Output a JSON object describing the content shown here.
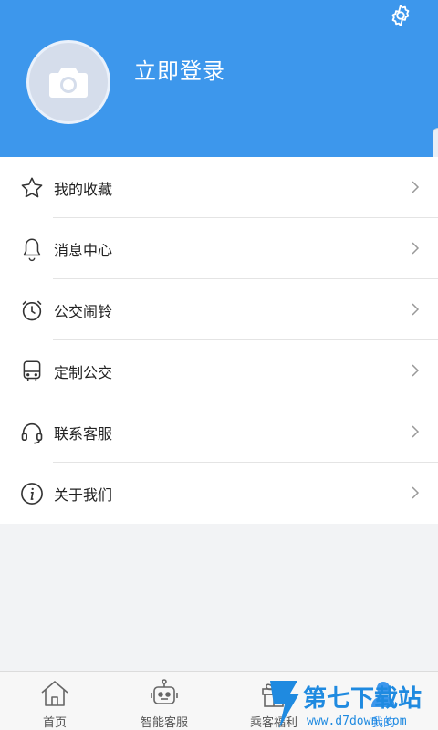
{
  "header": {
    "login_label": "立即登录",
    "background_color": "#3d97ec",
    "settings_icon": "gear-icon",
    "avatar_icon": "camera-icon"
  },
  "menu": {
    "items": [
      {
        "label": "我的收藏",
        "icon": "star-icon"
      },
      {
        "label": "消息中心",
        "icon": "bell-icon"
      },
      {
        "label": "公交闹铃",
        "icon": "alarm-clock-icon"
      },
      {
        "label": "定制公交",
        "icon": "bus-icon"
      },
      {
        "label": "联系客服",
        "icon": "headset-icon"
      },
      {
        "label": "关于我们",
        "icon": "info-icon"
      }
    ]
  },
  "tabbar": {
    "tabs": [
      {
        "label": "首页",
        "icon": "home-icon"
      },
      {
        "label": "智能客服",
        "icon": "robot-icon"
      },
      {
        "label": "乘客福利",
        "icon": "gift-icon"
      },
      {
        "label": "我的",
        "icon": "user-icon",
        "active": true
      }
    ]
  },
  "watermark": {
    "title": "第七下载站",
    "url": "www.d7down.com"
  }
}
